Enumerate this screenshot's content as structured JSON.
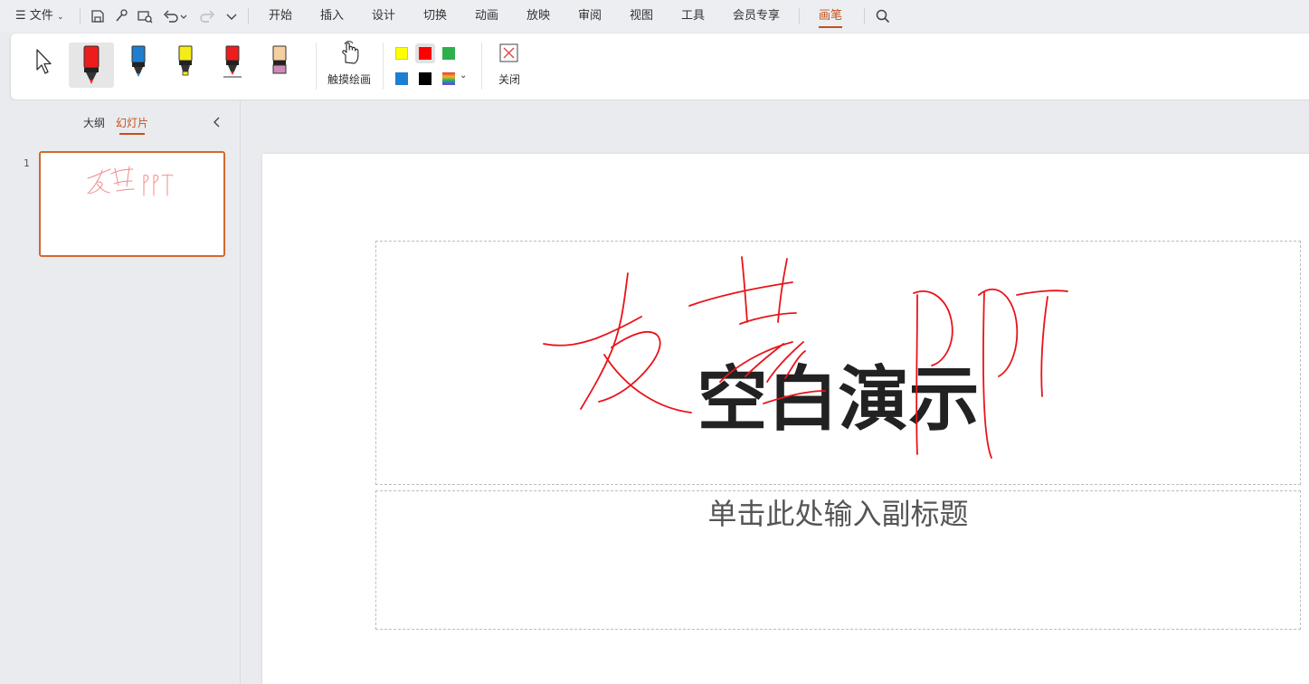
{
  "menubar": {
    "file_label": "文件",
    "tabs": [
      "开始",
      "插入",
      "设计",
      "切换",
      "动画",
      "放映",
      "审阅",
      "视图",
      "工具",
      "会员专享",
      "画笔"
    ],
    "active_tab": "画笔"
  },
  "ribbon": {
    "touch_draw_label": "触摸绘画",
    "close_label": "关闭",
    "pens": [
      {
        "name": "red-marker",
        "color": "#ee1c1c"
      },
      {
        "name": "blue-pen",
        "color": "#1e7fd0"
      },
      {
        "name": "yellow-highlighter",
        "color": "#f5ec1a"
      },
      {
        "name": "red-pen",
        "color": "#ee1c1c"
      },
      {
        "name": "peach-pen",
        "color": "#f6cfa0"
      }
    ],
    "colors": [
      "#ffff00",
      "#ff0000",
      "#2db04b",
      "#1c7fd2",
      "#000000"
    ]
  },
  "leftpanel": {
    "tab_outline": "大纲",
    "tab_slides": "幻灯片",
    "slide_number": "1"
  },
  "slide": {
    "title": "空白演示",
    "subtitle": "单击此处输入副标题",
    "ink_color": "#e8141a"
  }
}
